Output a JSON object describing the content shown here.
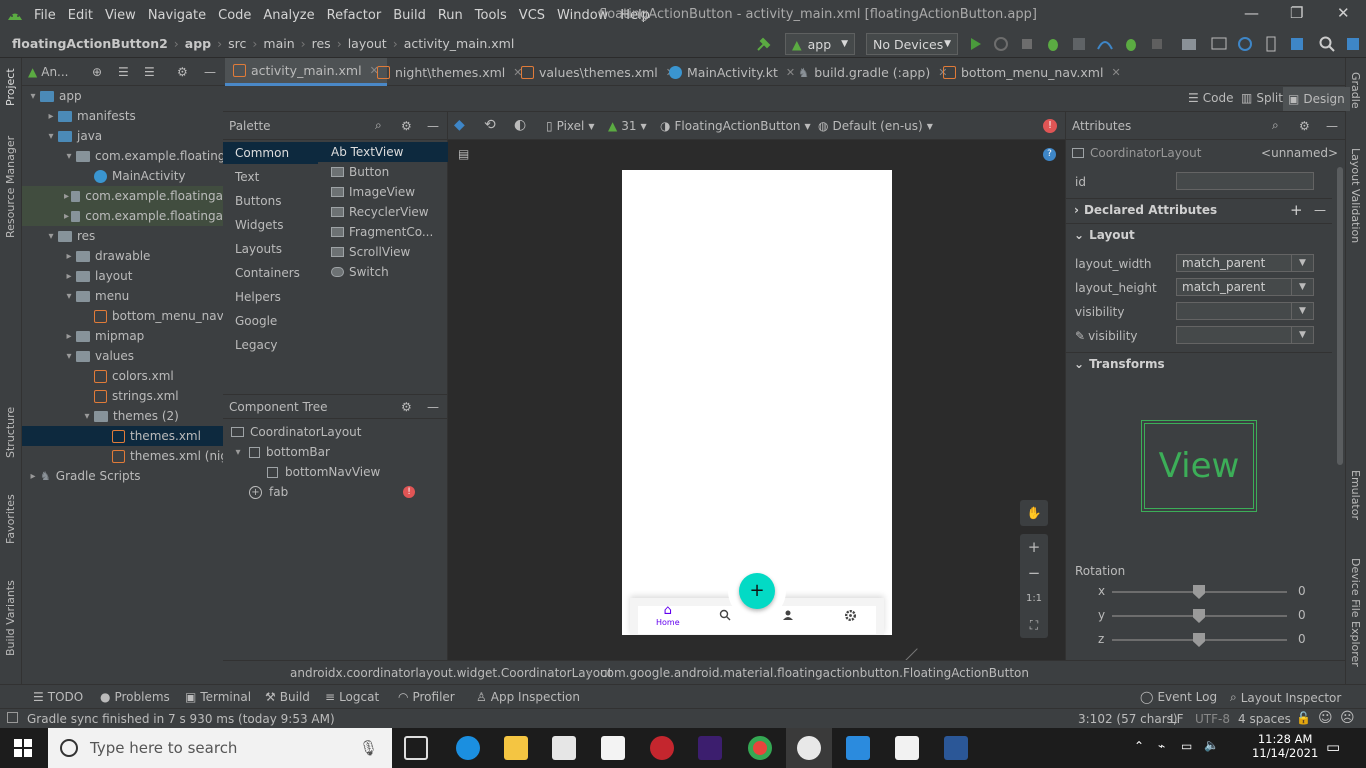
{
  "colors": {
    "accent": "#4a88c7",
    "fab": "#03dac5",
    "navActive": "#6200ee",
    "error": "#e05555",
    "green": "#5bab42"
  },
  "menubar": {
    "items": [
      "File",
      "Edit",
      "View",
      "Navigate",
      "Code",
      "Analyze",
      "Refactor",
      "Build",
      "Run",
      "Tools",
      "VCS",
      "Window",
      "Help"
    ],
    "title": "floatingActionButton - activity_main.xml [floatingActionButton.app]"
  },
  "navbar": {
    "crumbs": [
      "floatingActionButton2",
      "app",
      "src",
      "main",
      "res",
      "layout",
      "activity_main.xml"
    ],
    "run_config": "app",
    "device": "No Devices"
  },
  "left_strip": [
    "Project",
    "Resource Manager",
    "Structure",
    "Favorites",
    "Build Variants"
  ],
  "right_strip": [
    "Gradle",
    "Layout Validation",
    "Emulator",
    "Device File Explorer"
  ],
  "project": {
    "header": "An...",
    "tree": [
      {
        "label": "app",
        "kind": "folder-blue",
        "indent": 0,
        "arrow": "▾"
      },
      {
        "label": "manifests",
        "kind": "folder-blue",
        "indent": 1,
        "arrow": "▸"
      },
      {
        "label": "java",
        "kind": "folder-blue",
        "indent": 1,
        "arrow": "▾"
      },
      {
        "label": "com.example.floatinga",
        "kind": "folder",
        "indent": 2,
        "arrow": "▾"
      },
      {
        "label": "MainActivity",
        "kind": "kt",
        "indent": 3,
        "arrow": ""
      },
      {
        "label": "com.example.floatinga",
        "kind": "folder",
        "indent": 2,
        "arrow": "▸"
      },
      {
        "label": "com.example.floatinga",
        "kind": "folder",
        "indent": 2,
        "arrow": "▸"
      },
      {
        "label": "res",
        "kind": "folder",
        "indent": 1,
        "arrow": "▾"
      },
      {
        "label": "drawable",
        "kind": "folder",
        "indent": 2,
        "arrow": "▸"
      },
      {
        "label": "layout",
        "kind": "folder",
        "indent": 2,
        "arrow": "▸"
      },
      {
        "label": "menu",
        "kind": "folder",
        "indent": 2,
        "arrow": "▾"
      },
      {
        "label": "bottom_menu_nav.",
        "kind": "xml",
        "indent": 3,
        "arrow": ""
      },
      {
        "label": "mipmap",
        "kind": "folder",
        "indent": 2,
        "arrow": "▸"
      },
      {
        "label": "values",
        "kind": "folder",
        "indent": 2,
        "arrow": "▾"
      },
      {
        "label": "colors.xml",
        "kind": "xml",
        "indent": 3,
        "arrow": ""
      },
      {
        "label": "strings.xml",
        "kind": "xml",
        "indent": 3,
        "arrow": ""
      },
      {
        "label": "themes (2)",
        "kind": "folder",
        "indent": 3,
        "arrow": "▾"
      },
      {
        "label": "themes.xml",
        "kind": "xml",
        "indent": 4,
        "arrow": ""
      },
      {
        "label": "themes.xml (nig",
        "kind": "xml",
        "indent": 4,
        "arrow": ""
      },
      {
        "label": "Gradle Scripts",
        "kind": "gradle",
        "indent": 0,
        "arrow": "▸"
      }
    ]
  },
  "editor_tabs": [
    "activity_main.xml",
    "night\\themes.xml",
    "values\\themes.xml",
    "MainActivity.kt",
    "build.gradle (:app)",
    "bottom_menu_nav.xml"
  ],
  "view_modes": [
    "Code",
    "Split",
    "Design"
  ],
  "palette": {
    "title": "Palette",
    "categories": [
      "Common",
      "Text",
      "Buttons",
      "Widgets",
      "Layouts",
      "Containers",
      "Helpers",
      "Google",
      "Legacy"
    ],
    "items": [
      "Ab TextView",
      "Button",
      "ImageView",
      "RecyclerView",
      "FragmentCo...",
      "ScrollView",
      "Switch"
    ]
  },
  "component_tree": {
    "title": "Component Tree",
    "nodes": [
      "CoordinatorLayout",
      "bottomBar",
      "bottomNavView",
      "fab"
    ]
  },
  "design_toolbar": {
    "device": "Pixel",
    "api": "31",
    "theme": "FloatingActionButton",
    "locale": "Default (en-us)"
  },
  "phone": {
    "nav_home": "Home",
    "fab_symbol": "+"
  },
  "zoom": [
    "1:1"
  ],
  "attributes": {
    "title": "Attributes",
    "component": "CoordinatorLayout",
    "component_name": "<unnamed>",
    "id_label": "id",
    "declared": "Declared Attributes",
    "layout": "Layout",
    "layout_width_label": "layout_width",
    "layout_width": "match_parent",
    "layout_height_label": "layout_height",
    "layout_height": "match_parent",
    "visibility_label": "visibility",
    "visibility_tool_label": "visibility",
    "transforms": "Transforms",
    "preview_text": "View",
    "rotation": "Rotation",
    "axes": [
      {
        "name": "x",
        "value": "0"
      },
      {
        "name": "y",
        "value": "0"
      },
      {
        "name": "z",
        "value": "0"
      }
    ]
  },
  "pathbar": [
    "androidx.coordinatorlayout.widget.CoordinatorLayout",
    "com.google.android.material.floatingactionbutton.FloatingActionButton"
  ],
  "bottom_tools": {
    "left": [
      "TODO",
      "Problems",
      "Terminal",
      "Build",
      "Logcat",
      "Profiler",
      "App Inspection"
    ],
    "right": [
      "Event Log",
      "Layout Inspector"
    ]
  },
  "status": {
    "message": "Gradle sync finished in 7 s 930 ms (today 9:53 AM)",
    "position": "3:102 (57 chars)",
    "lf": "LF",
    "encoding": "UTF-8",
    "indent": "4 spaces"
  },
  "taskbar": {
    "search_placeholder": "Type here to search",
    "time": "11:28 AM",
    "date": "11/14/2021"
  }
}
